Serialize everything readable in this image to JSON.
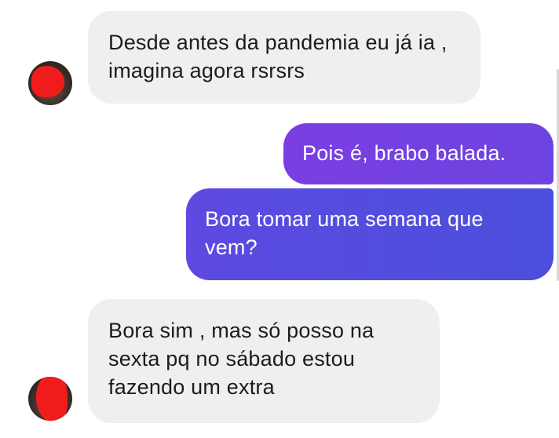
{
  "conversation": {
    "messages": [
      {
        "direction": "incoming",
        "text": "Desde antes da pandemia eu já ia , imagina agora rsrsrs"
      },
      {
        "direction": "outgoing",
        "text": "Pois é, brabo balada."
      },
      {
        "direction": "outgoing",
        "text": "Bora tomar uma semana que vem?"
      },
      {
        "direction": "incoming",
        "text": "Bora sim , mas só posso na sexta pq no sábado estou fazendo um extra"
      }
    ]
  },
  "colors": {
    "incoming_bubble": "#efefef",
    "outgoing_gradient_start": "#7b3fe0",
    "outgoing_gradient_end": "#4a4fdc",
    "avatar_redaction": "#f01c1c"
  }
}
